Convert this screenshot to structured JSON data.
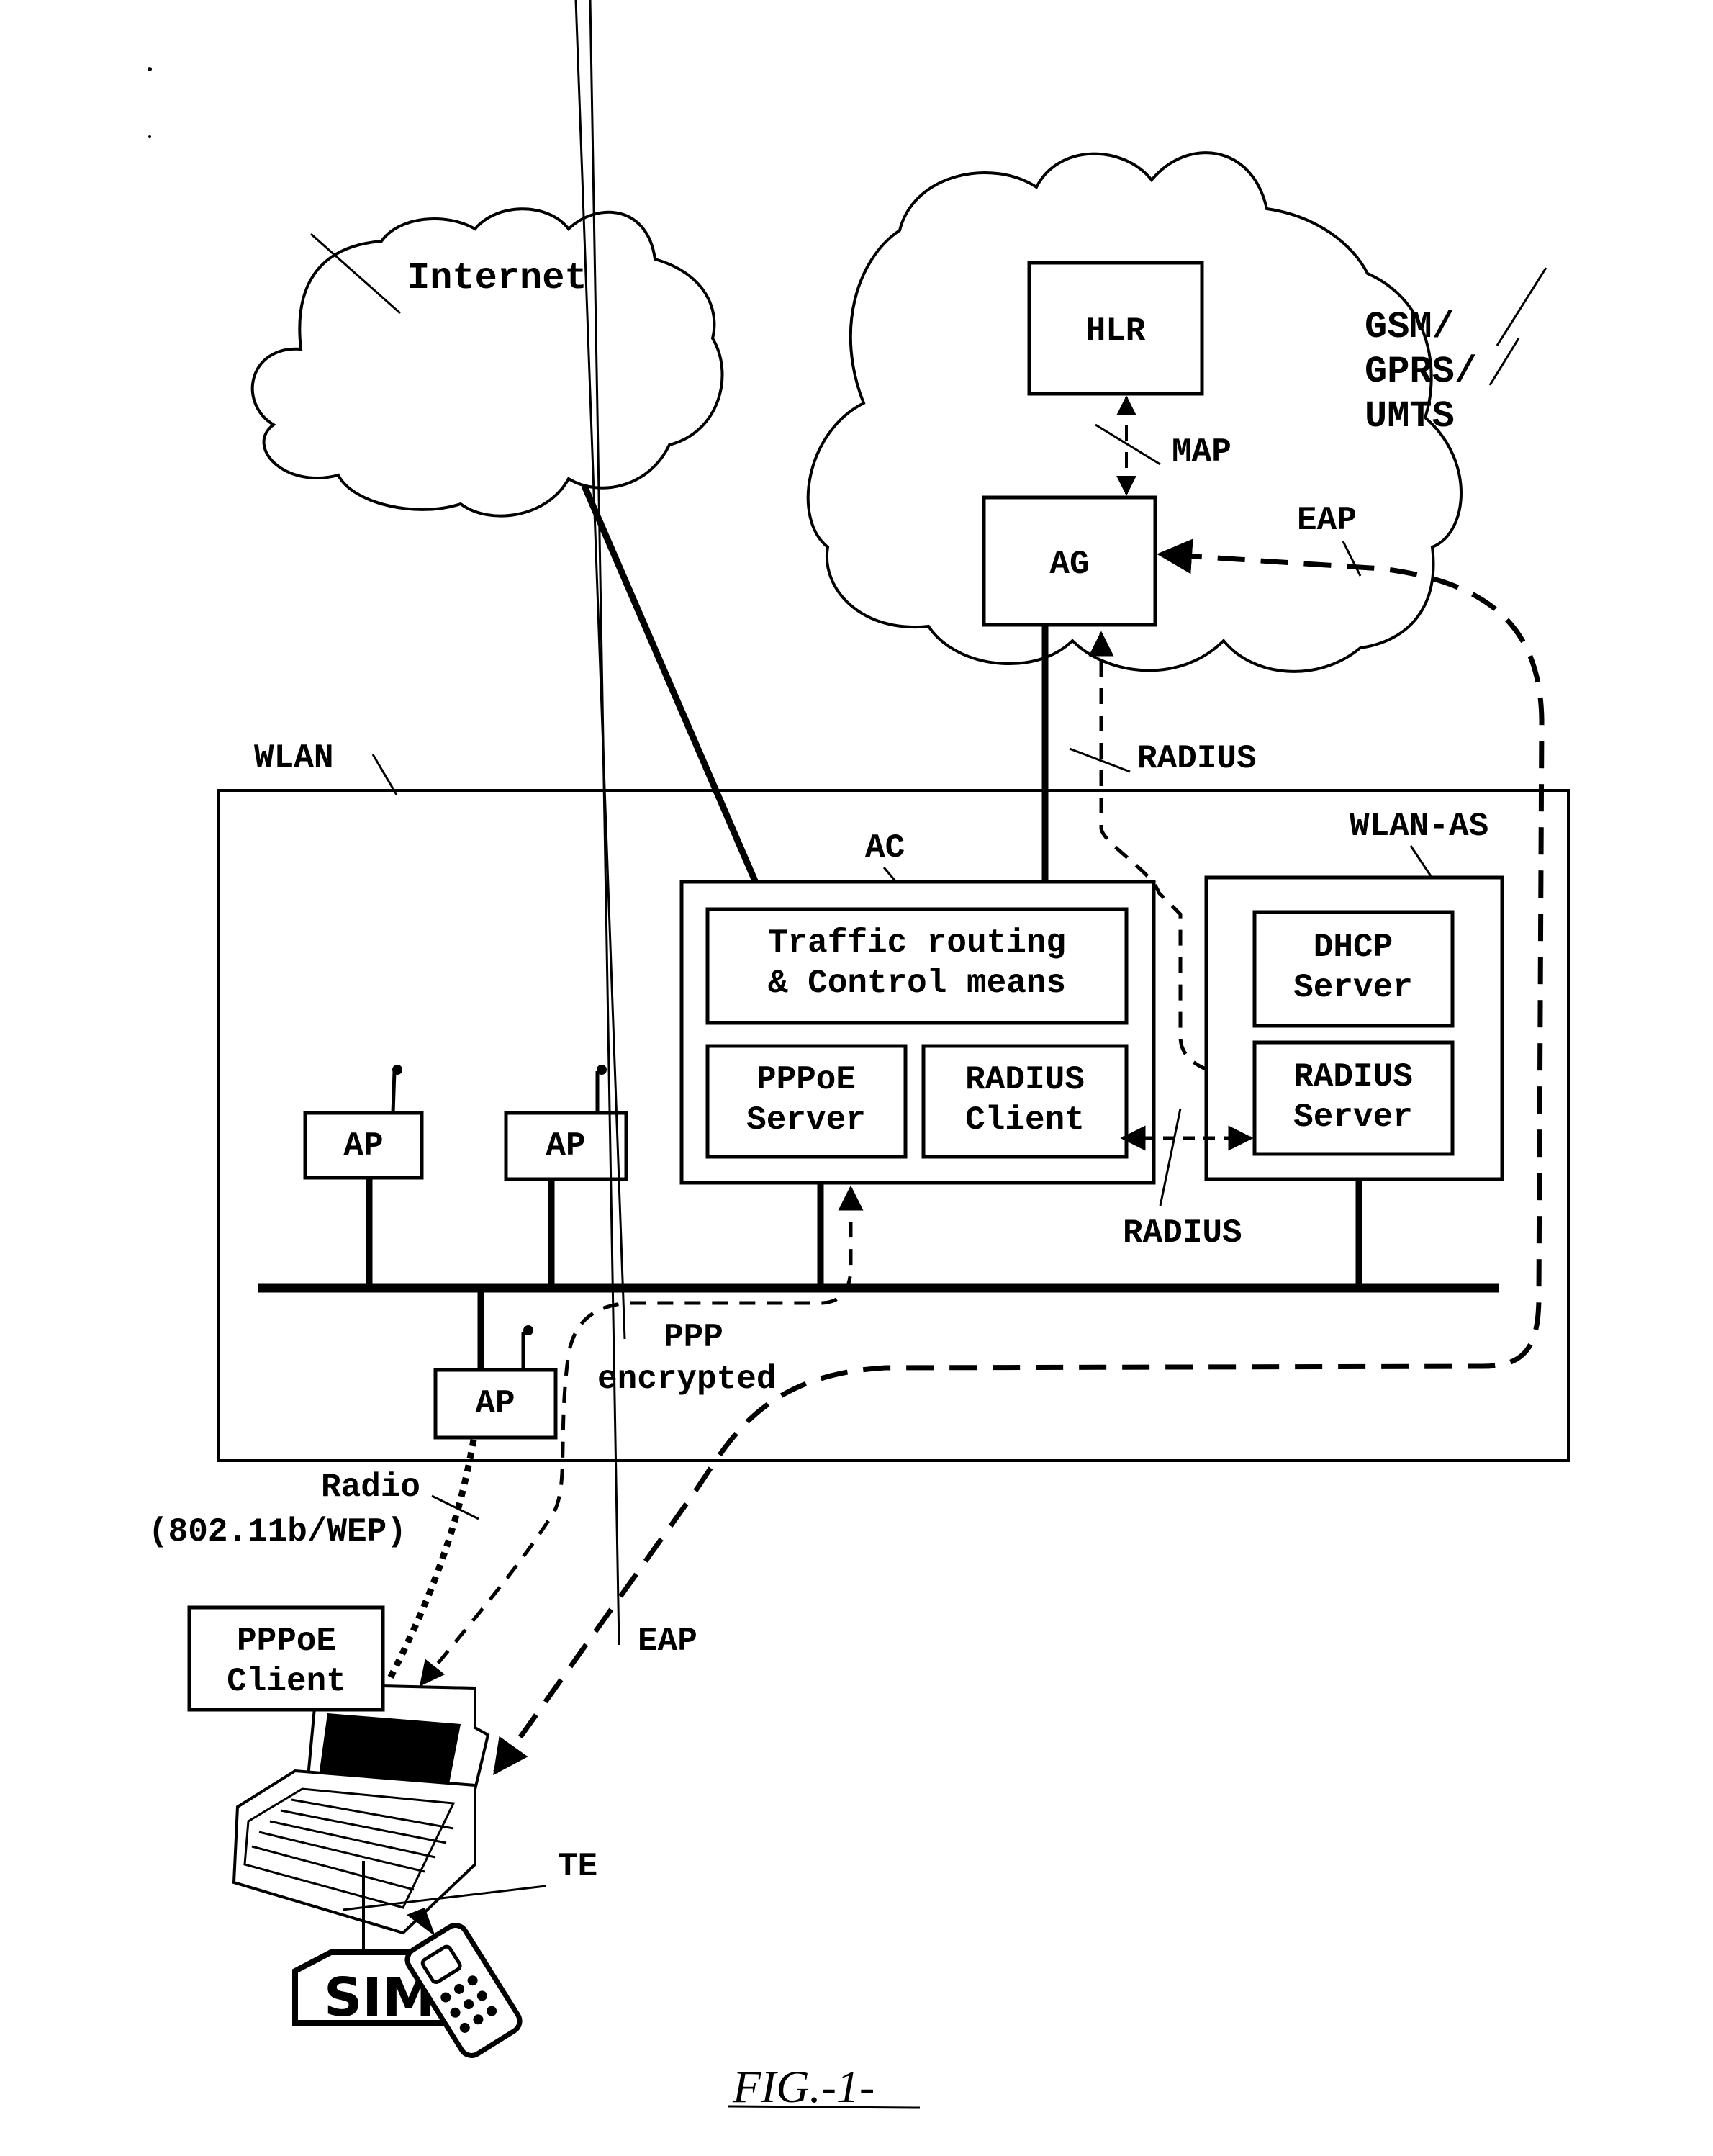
{
  "figure": {
    "caption": "FIG.-1-",
    "networks": {
      "internet": "Internet",
      "mobile_line1": "GSM/",
      "mobile_line2": "GPRS/",
      "mobile_line3": "UMTS",
      "wlan": "WLAN"
    },
    "nodes": {
      "hlr": "HLR",
      "ag": "AG",
      "ac": "AC",
      "traffic_line1": "Traffic routing",
      "traffic_line2": "& Control means",
      "pppoe_server_line1": "PPPoE",
      "pppoe_server_line2": "Server",
      "radius_client_line1": "RADIUS",
      "radius_client_line2": "Client",
      "wlan_as": "WLAN-AS",
      "dhcp_line1": "DHCP",
      "dhcp_line2": "Server",
      "radius_server_line1": "RADIUS",
      "radius_server_line2": "Server",
      "ap": [
        "AP",
        "AP",
        "AP"
      ],
      "pppoe_client_line1": "PPPoE",
      "pppoe_client_line2": "Client",
      "te": "TE",
      "sim": "SIM"
    },
    "links": {
      "map": "MAP",
      "eap_top": "EAP",
      "radius_top": "RADIUS",
      "radius_mid": "RADIUS",
      "ppp_line1": "PPP",
      "ppp_line2": "encrypted",
      "radio_line1": "Radio",
      "radio_line2": "(802.11b/WEP)",
      "eap_bottom": "EAP"
    }
  }
}
